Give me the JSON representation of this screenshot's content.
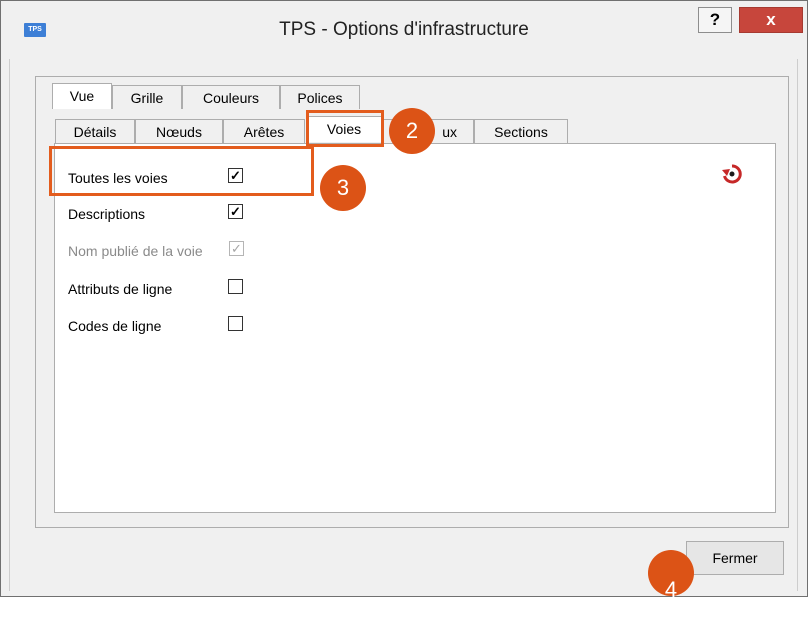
{
  "window": {
    "app_icon_text": "TPS",
    "title": "TPS  - Options d'infrastructure",
    "help_label": "?",
    "close_label": "x"
  },
  "top_tabs": [
    {
      "label": "Vue",
      "active": true
    },
    {
      "label": "Grille",
      "active": false
    },
    {
      "label": "Couleurs",
      "active": false
    },
    {
      "label": "Polices",
      "active": false
    }
  ],
  "sub_tabs": [
    {
      "label": "Détails",
      "active": false
    },
    {
      "label": "Nœuds",
      "active": false
    },
    {
      "label": "Arêtes",
      "active": false
    },
    {
      "label": "Voies",
      "active": true
    },
    {
      "label": "ux",
      "active": false
    },
    {
      "label": "Sections",
      "active": false
    }
  ],
  "options": [
    {
      "label": "Toutes les voies",
      "checked": true,
      "enabled": true
    },
    {
      "label": "Descriptions",
      "checked": true,
      "enabled": true
    },
    {
      "label": "Nom publié de la voie",
      "checked": true,
      "enabled": false
    },
    {
      "label": "Attributs de ligne",
      "checked": false,
      "enabled": true
    },
    {
      "label": "Codes de ligne",
      "checked": false,
      "enabled": true
    }
  ],
  "checkmark": "✓",
  "reset_icon": "reset-icon",
  "footer": {
    "close_button_label": "Fermer"
  },
  "markers": {
    "m2": "2",
    "m3": "3",
    "m4": "4"
  },
  "colors": {
    "highlight": "#e35c1d",
    "marker": "#dc5316",
    "title_close": "#c7463c"
  }
}
